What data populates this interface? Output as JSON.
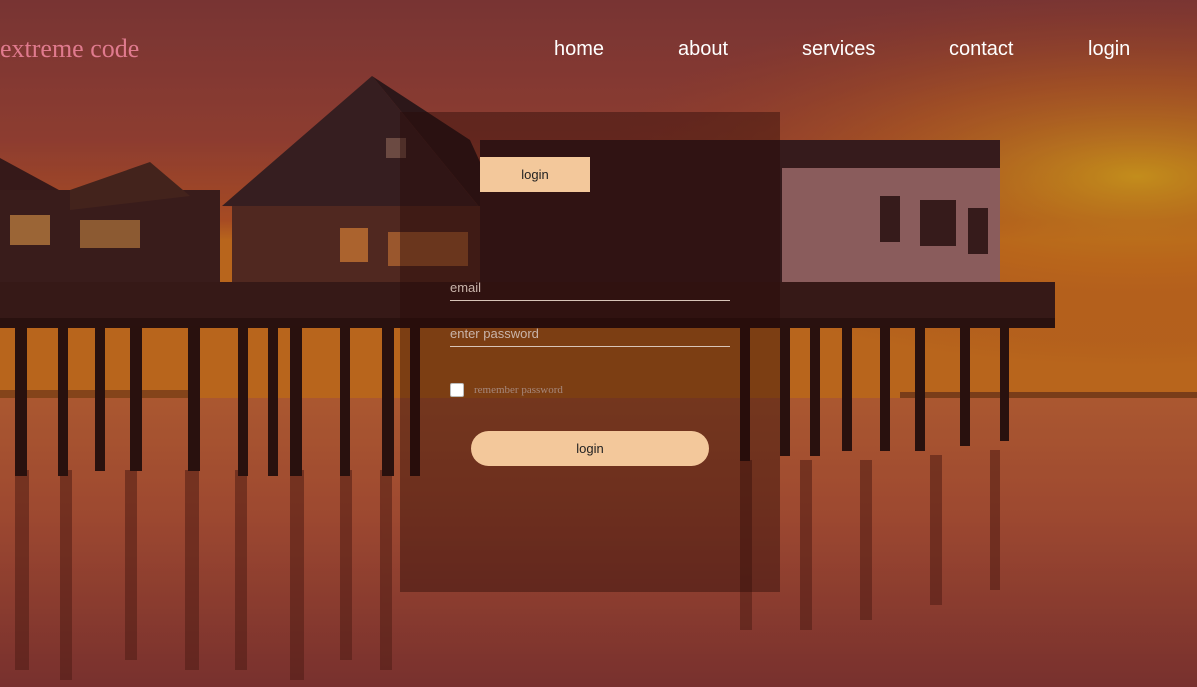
{
  "brand": {
    "logo": "extreme code",
    "logo_color": "#e07a8e"
  },
  "nav": {
    "items": [
      {
        "label": "home"
      },
      {
        "label": "about"
      },
      {
        "label": "services"
      },
      {
        "label": "contact"
      },
      {
        "label": "login"
      }
    ]
  },
  "login_form": {
    "tab_label": "login",
    "email": {
      "value": "",
      "placeholder": "email"
    },
    "password": {
      "value": "",
      "placeholder": "enter password"
    },
    "remember": {
      "label": "remember password",
      "checked": false
    },
    "submit_label": "login",
    "accent_color": "#f3c89b"
  },
  "background": {
    "description_icon": "pier-sunset-image"
  }
}
